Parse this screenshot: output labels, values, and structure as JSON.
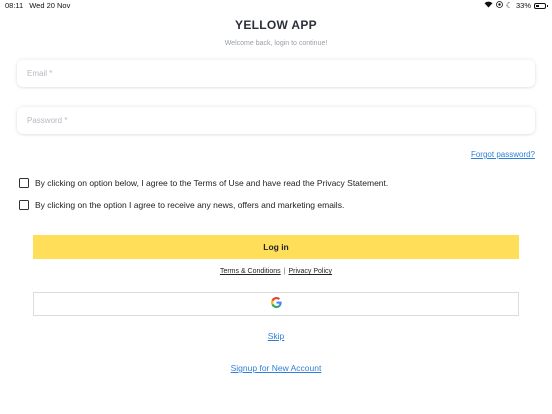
{
  "status_bar": {
    "time": "08:11",
    "date": "Wed 20 Nov",
    "battery_percent": "33%",
    "battery_level": 0.33
  },
  "header": {
    "title": "YELLOW APP",
    "subtitle": "Welcome back, login to continue!"
  },
  "form": {
    "email_placeholder": "Email *",
    "email_value": "",
    "password_placeholder": "Password *",
    "password_value": "",
    "forgot_label": "Forgot password?"
  },
  "consents": [
    {
      "label": "By clicking on option below, I agree to the Terms of Use and have read the Privacy Statement.",
      "checked": false
    },
    {
      "label": "By clicking on the option I agree to receive any news, offers and marketing emails.",
      "checked": false
    }
  ],
  "actions": {
    "login_label": "Log in",
    "terms_label": "Terms & Conditions",
    "separator": "|",
    "privacy_label": "Privacy Policy",
    "google_icon": "google-g-icon",
    "skip_label": "Skip",
    "signup_label": "Signup for New Account"
  },
  "colors": {
    "accent": "#ffdf5a",
    "link": "#2f7fd8",
    "title": "#2b2f3a"
  }
}
